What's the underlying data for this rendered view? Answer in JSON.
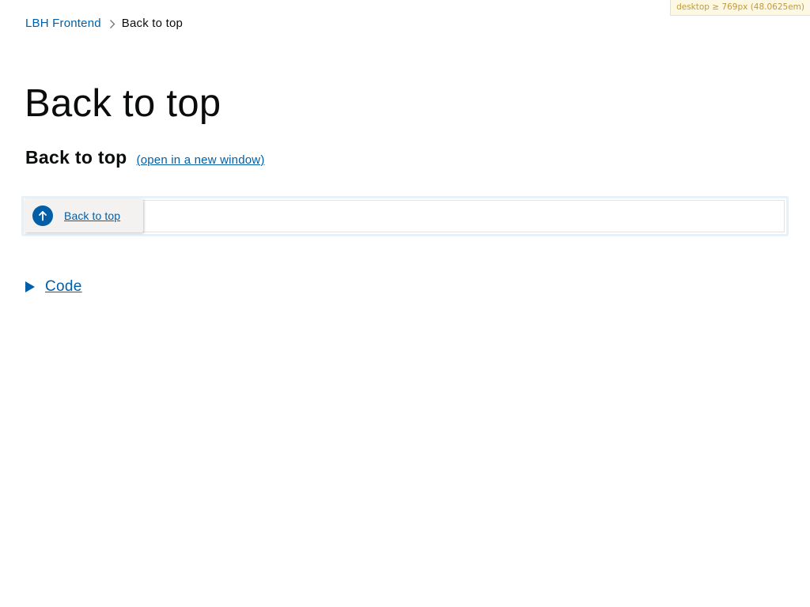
{
  "breakpoint_badge": "desktop ≥ 769px (48.0625em)",
  "breadcrumbs": {
    "home_label": "LBH Frontend",
    "current_label": "Back to top",
    "separator_icon": "chevron-right-icon"
  },
  "page": {
    "title": "Back to top"
  },
  "example": {
    "heading": "Back to top",
    "new_window_link": "(open in a new window)",
    "component": {
      "label": "Back to top",
      "icon": "arrow-up-circle-icon"
    }
  },
  "code_toggle": {
    "label": "Code",
    "icon": "triangle-right-icon"
  },
  "colors": {
    "link": "#025ea6",
    "text": "#0b0c0c",
    "badge_bg": "#fcf8e3",
    "badge_text": "#c19a3e",
    "frame_border": "#e8f1f8",
    "component_bg": "#f3f2f1"
  }
}
